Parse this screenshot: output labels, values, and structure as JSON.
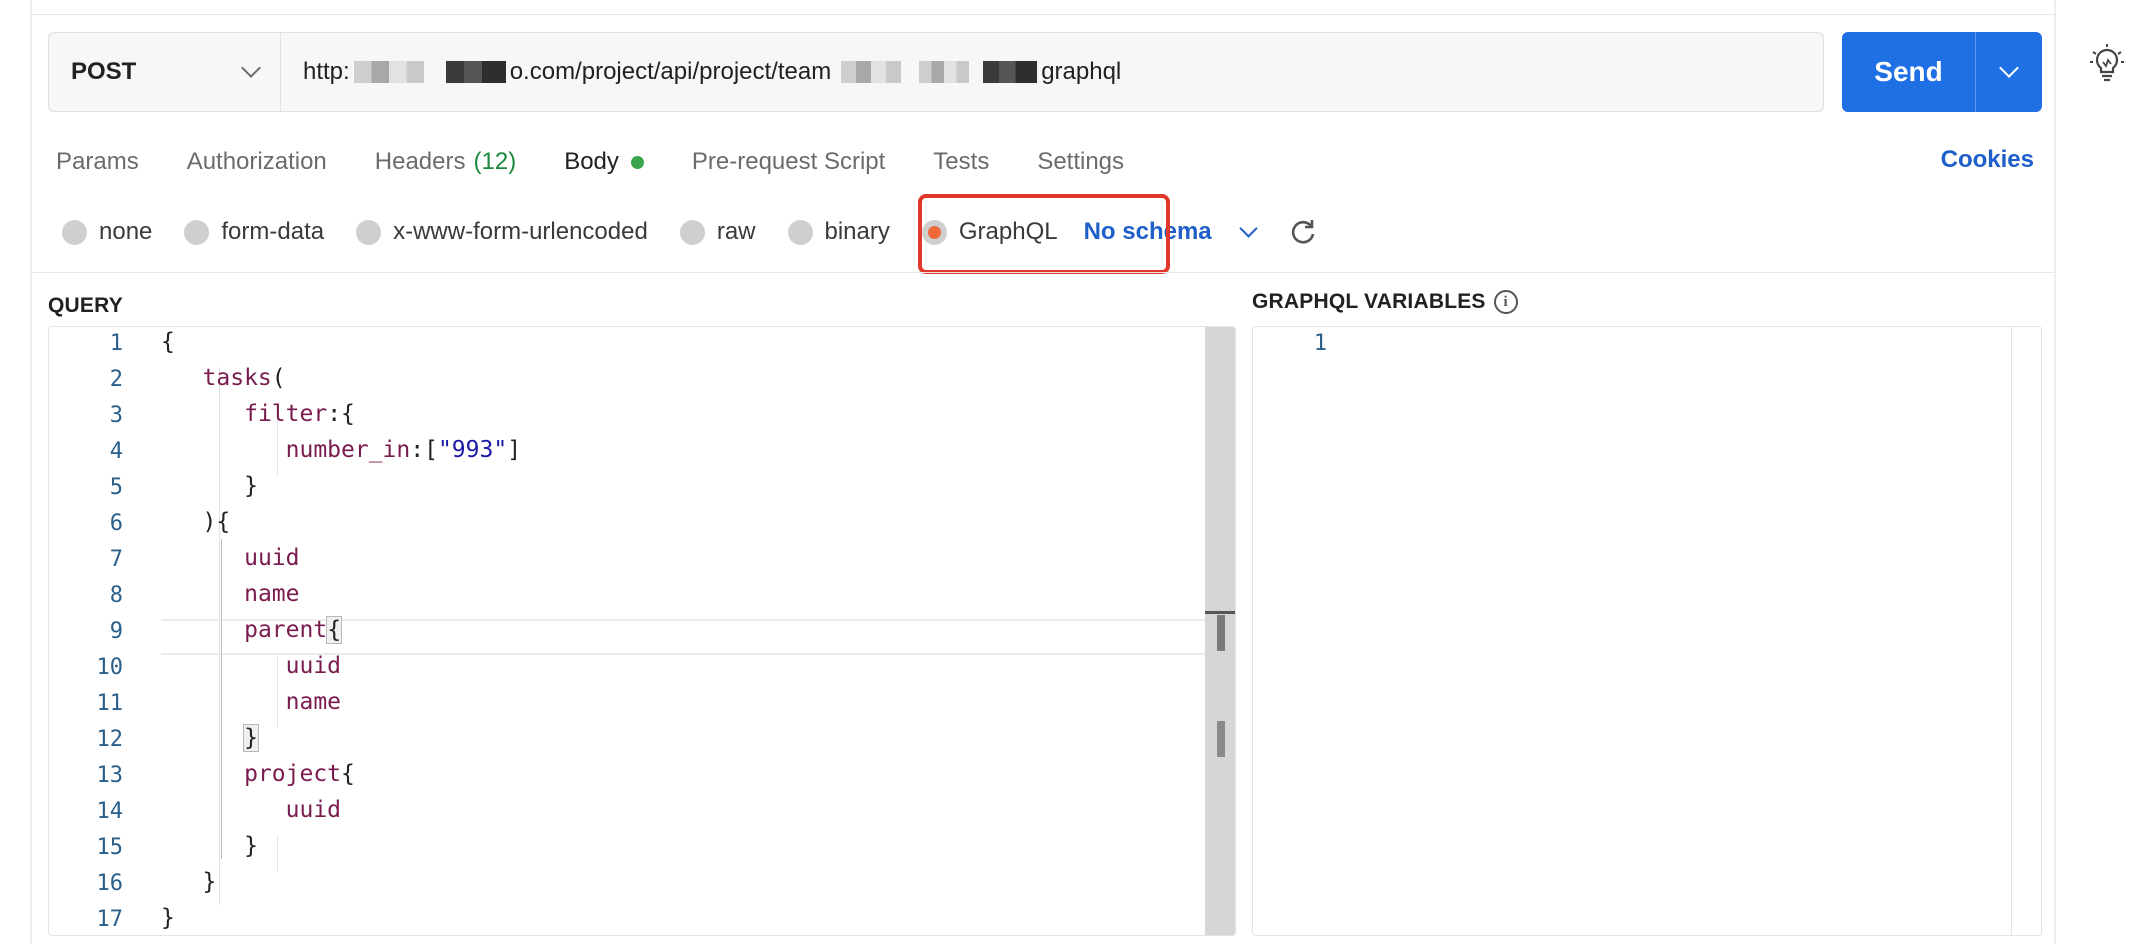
{
  "request": {
    "method": "POST",
    "url_parts": [
      "http:",
      "o.com/project/api/project/team",
      "graphql"
    ],
    "send_label": "Send"
  },
  "tabs": [
    {
      "label": "Params"
    },
    {
      "label": "Authorization"
    },
    {
      "label": "Headers",
      "count": "(12)"
    },
    {
      "label": "Body",
      "active": true
    },
    {
      "label": "Pre-request Script"
    },
    {
      "label": "Tests"
    },
    {
      "label": "Settings"
    }
  ],
  "cookies_label": "Cookies",
  "body_modes": [
    "none",
    "form-data",
    "x-www-form-urlencoded",
    "raw",
    "binary",
    "GraphQL"
  ],
  "selected_mode": "GraphQL",
  "schema_label": "No schema",
  "query_title": "QUERY",
  "variables_title": "GRAPHQL VARIABLES",
  "query_line_numbers": [
    "1",
    "2",
    "3",
    "4",
    "5",
    "6",
    "7",
    "8",
    "9",
    "10",
    "11",
    "12",
    "13",
    "14",
    "15",
    "16",
    "17"
  ],
  "variables_line_numbers": [
    "1"
  ],
  "query_code": {
    "l1": "{",
    "l2_kw": "tasks",
    "l2_rest": "(",
    "l3_kw": "filter",
    "l3_rest": ":{",
    "l4_kw": "number_in",
    "l4_a": ":[",
    "l4_str": "\"993\"",
    "l4_b": "]",
    "l5": "}",
    "l6": "){",
    "l7_kw": "uuid",
    "l8_kw": "name",
    "l9_kw": "parent",
    "l9_rest": "{",
    "l10_kw": "uuid",
    "l11_kw": "name",
    "l12": "}",
    "l13_kw": "project",
    "l13_rest": "{",
    "l14_kw": "uuid",
    "l15": "}",
    "l16": "}",
    "l17": "}"
  },
  "colors": {
    "accent": "#1f6fe5",
    "link": "#1f5fc9",
    "keyword": "#7a1b4f",
    "string": "#1a1aa6",
    "radio_selected": "#ef6a3a",
    "highlight_box": "#e0392b",
    "body_dot": "#3aa64b"
  },
  "icons": [
    "chevron-down-icon",
    "lightbulb-icon",
    "refresh-icon",
    "info-icon"
  ]
}
